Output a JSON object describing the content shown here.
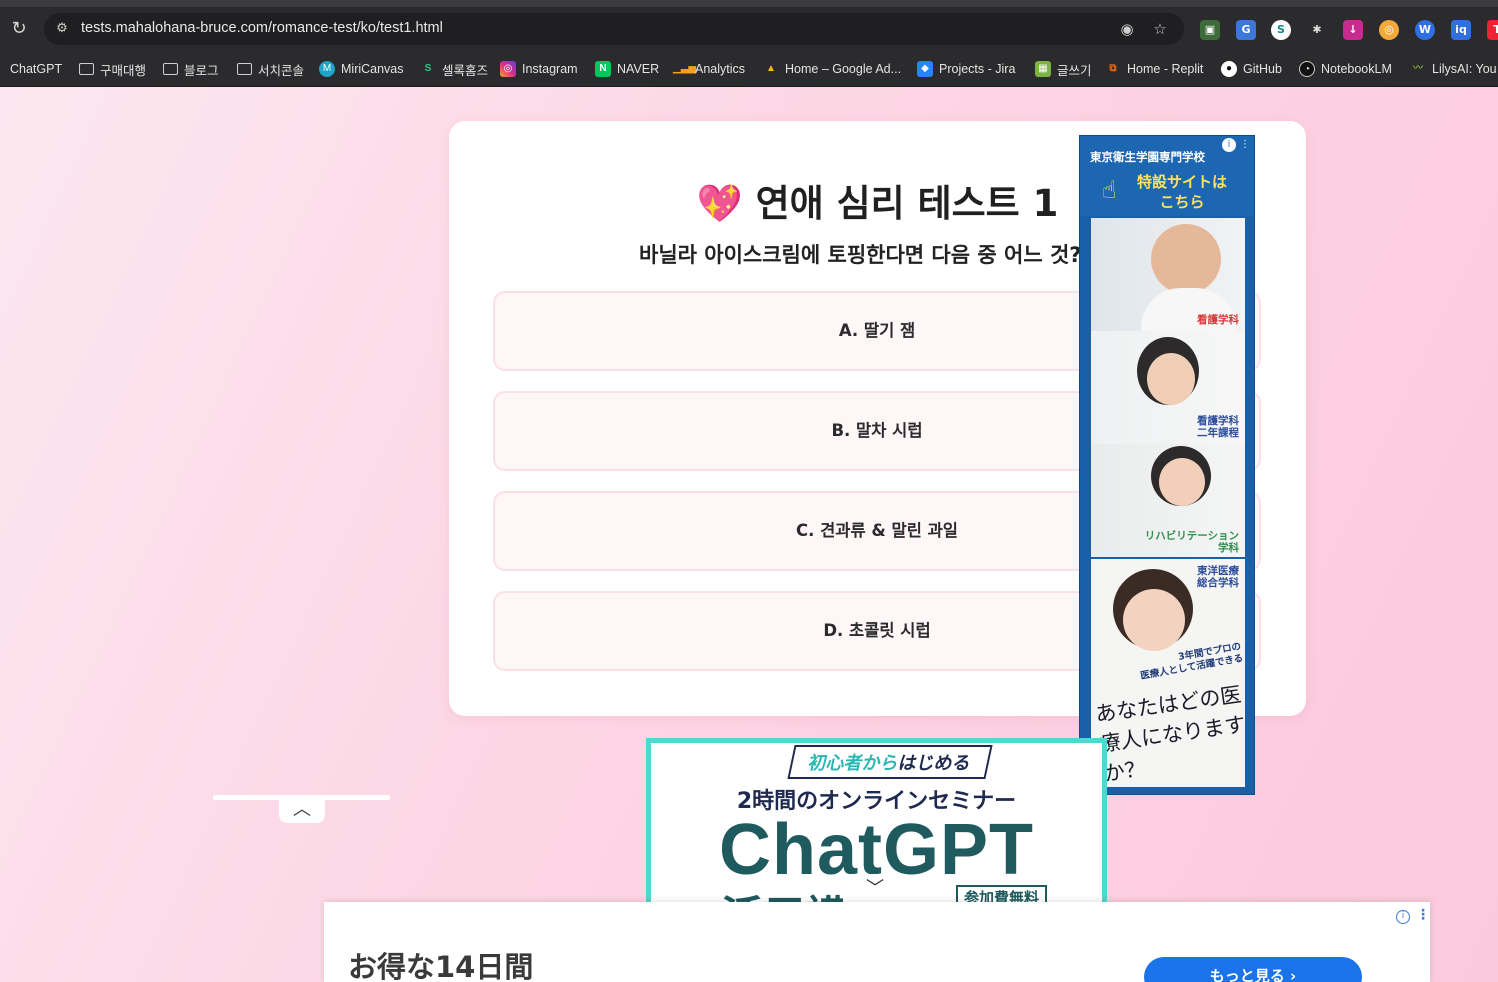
{
  "browser": {
    "url": "tests.mahalohana-bruce.com/romance-test/ko/test1.html",
    "bookmarks": [
      {
        "label": "ChatGPT",
        "icon": "chatgpt-icon"
      },
      {
        "label": "구매대행",
        "icon": "folder-icon"
      },
      {
        "label": "블로그",
        "icon": "folder-icon"
      },
      {
        "label": "서치콘솔",
        "icon": "folder-icon"
      },
      {
        "label": "MiriCanvas",
        "icon": "miricanvas-icon"
      },
      {
        "label": "셀록홈즈",
        "icon": "sellok-icon"
      },
      {
        "label": "Instagram",
        "icon": "instagram-icon"
      },
      {
        "label": "NAVER",
        "icon": "naver-icon"
      },
      {
        "label": "Analytics",
        "icon": "analytics-icon"
      },
      {
        "label": "Home – Google Ad...",
        "icon": "google-ads-icon"
      },
      {
        "label": "Projects - Jira",
        "icon": "jira-icon"
      },
      {
        "label": "글쓰기",
        "icon": "write-icon"
      },
      {
        "label": "Home - Replit",
        "icon": "replit-icon"
      },
      {
        "label": "GitHub",
        "icon": "github-icon"
      },
      {
        "label": "NotebookLM",
        "icon": "notebooklm-icon"
      },
      {
        "label": "LilysAI: You",
        "icon": "lilys-icon"
      }
    ]
  },
  "quiz": {
    "title_emoji": "💖",
    "title": "연애 심리 테스트 1",
    "question": "바닐라 아이스크림에 토핑한다면 다음 중 어느 것?",
    "options": [
      {
        "label": "A. 딸기 잼"
      },
      {
        "label": "B. 말차 시럽"
      },
      {
        "label": "C. 견과류 & 말린 과일"
      },
      {
        "label": "D. 초콜릿 시럽"
      }
    ]
  },
  "side_ad": {
    "school": "東京衛生学園専門学校",
    "cta_line1": "特設サイトは",
    "cta_line2": "こちら",
    "labels": [
      "看護学科",
      "看護学科\n二年課程",
      "リハビリテーション\n学科",
      "東洋医療\n総合学科"
    ],
    "sub": "3年間でプロの\n医療人として活躍できる",
    "question": "あなたはどの医療人になりますか？"
  },
  "center_ad": {
    "tag_lead": "初心者から",
    "tag_main": "はじめる",
    "subtitle": "2時間のオンラインセミナー",
    "main": "ChatGPT",
    "partial": "活用講座",
    "free": "参加費無料"
  },
  "bottom_ad": {
    "text": "お得な14日間",
    "button": "もっと見る ›"
  },
  "colors": {
    "page_bg": "#fdd5e4",
    "accent": "#e9408a",
    "ad_blue": "#1b5fa8",
    "cta_blue": "#1a73e8"
  }
}
